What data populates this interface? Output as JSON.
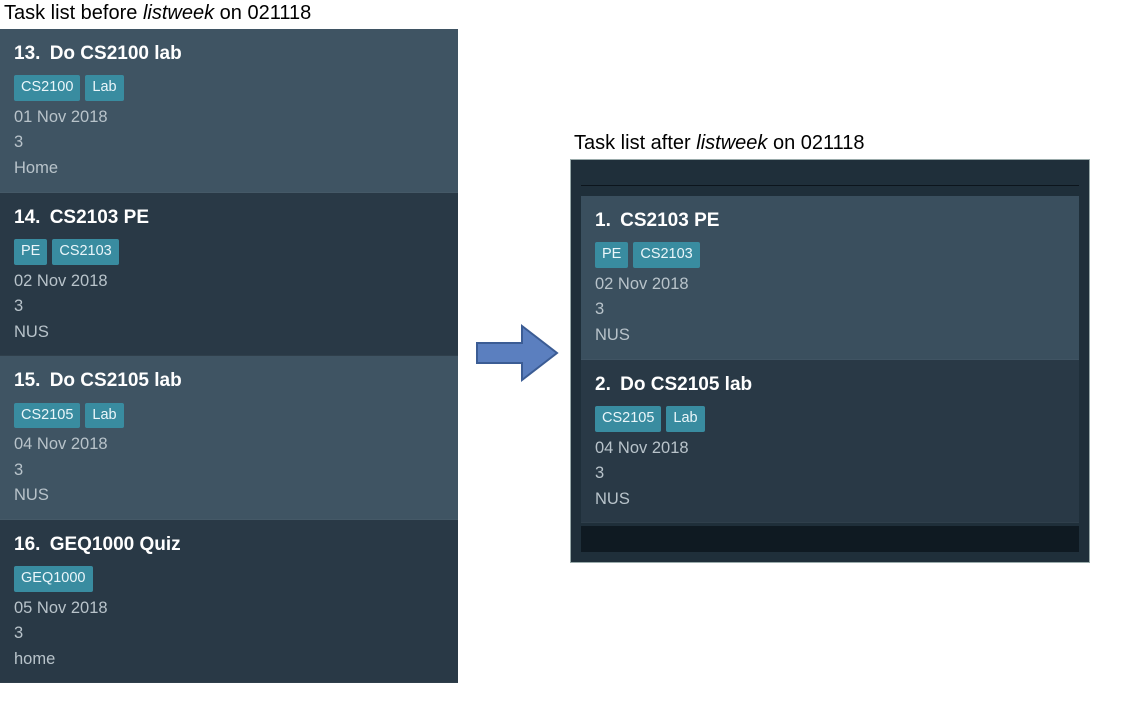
{
  "captions": {
    "before_pre": "Task list before ",
    "before_em": "listweek",
    "before_post": " on 021118",
    "after_pre": "Task list after ",
    "after_em": "listweek",
    "after_post": " on 021118"
  },
  "before": {
    "tasks": [
      {
        "num": "13.",
        "title": "Do CS2100 lab",
        "tags": [
          "CS2100",
          "Lab"
        ],
        "date": "01 Nov 2018",
        "priority": "3",
        "location": "Home",
        "shade": "light"
      },
      {
        "num": "14.",
        "title": "CS2103 PE",
        "tags": [
          "PE",
          "CS2103"
        ],
        "date": "02 Nov 2018",
        "priority": "3",
        "location": "NUS",
        "shade": "dark"
      },
      {
        "num": "15.",
        "title": "Do CS2105 lab",
        "tags": [
          "CS2105",
          "Lab"
        ],
        "date": "04 Nov 2018",
        "priority": "3",
        "location": "NUS",
        "shade": "light"
      },
      {
        "num": "16.",
        "title": "GEQ1000 Quiz",
        "tags": [
          "GEQ1000"
        ],
        "date": "05 Nov 2018",
        "priority": "3",
        "location": "home",
        "shade": "dark"
      }
    ]
  },
  "after": {
    "tasks": [
      {
        "num": "1.",
        "title": "CS2103 PE",
        "tags": [
          "PE",
          "CS2103"
        ],
        "date": "02 Nov 2018",
        "priority": "3",
        "location": "NUS",
        "shade": "light2"
      },
      {
        "num": "2.",
        "title": "Do CS2105 lab",
        "tags": [
          "CS2105",
          "Lab"
        ],
        "date": "04 Nov 2018",
        "priority": "3",
        "location": "NUS",
        "shade": "dark"
      }
    ]
  }
}
